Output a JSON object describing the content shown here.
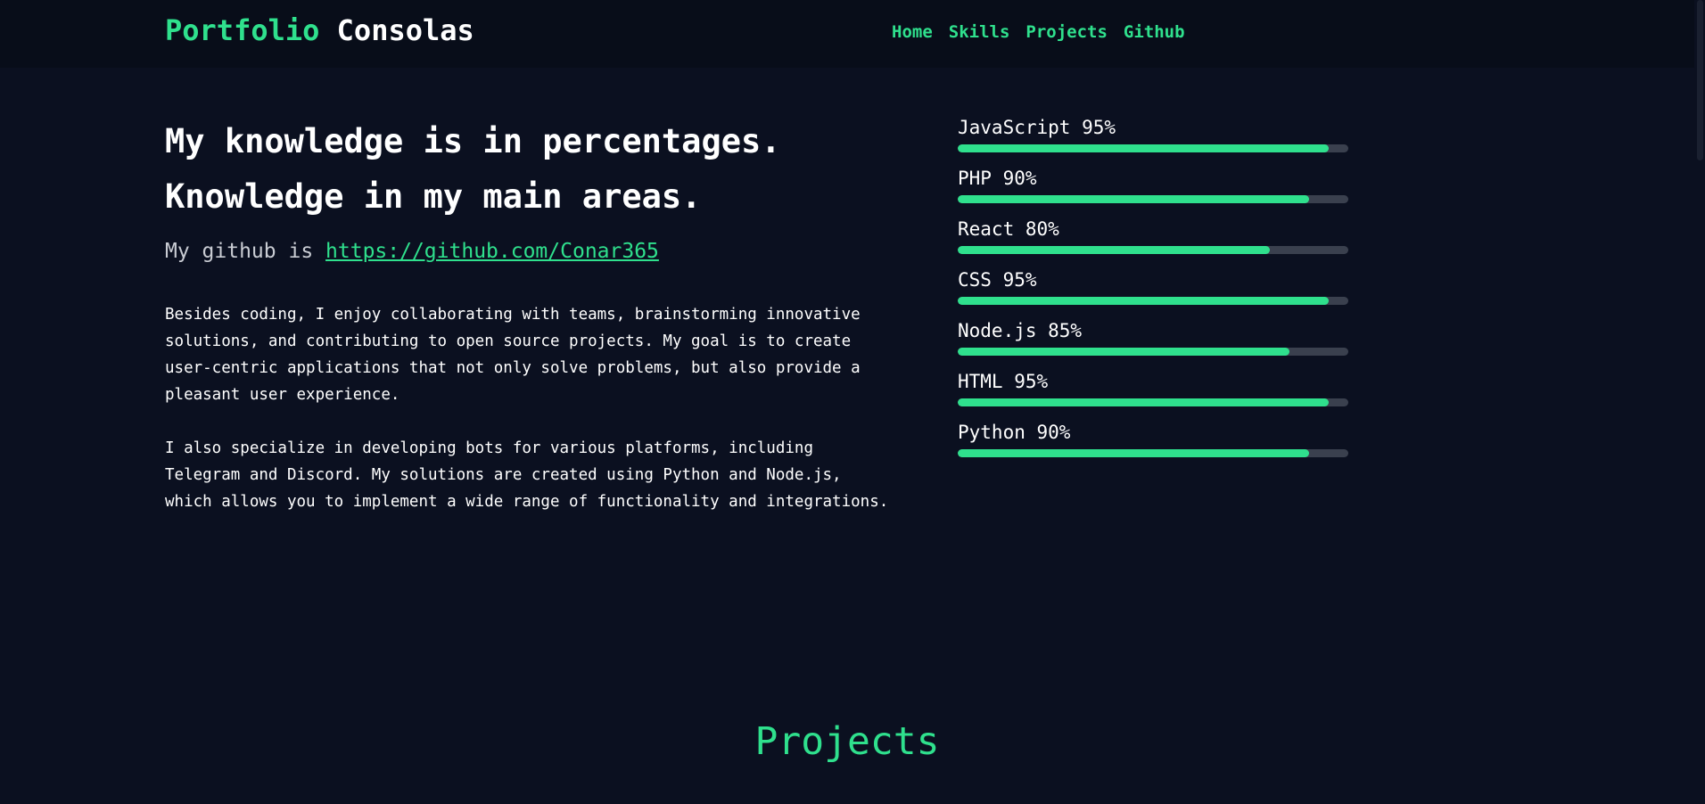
{
  "header": {
    "brand_first": "Portfolio",
    "brand_second": "Consolas",
    "nav": [
      {
        "label": "Home"
      },
      {
        "label": "Skills"
      },
      {
        "label": "Projects"
      },
      {
        "label": "Github"
      }
    ]
  },
  "about": {
    "headline_line1": "My knowledge is in percentages.",
    "headline_line2": "Knowledge in my main areas.",
    "github_prefix": "My github is",
    "github_link": "https://github.com/Conar365",
    "paragraph1": "Besides coding, I enjoy collaborating with teams, brainstorming innovative\nsolutions, and contributing to open source projects. My goal is to create\nuser-centric applications that not only solve problems, but also provide a\npleasant user experience.",
    "paragraph2": "I also specialize in developing bots for various platforms, including\nTelegram and Discord. My solutions are created using Python and Node.js,\nwhich allows you to implement a wide range of functionality and integrations."
  },
  "skills": [
    {
      "label": "JavaScript 95%",
      "percent": 95
    },
    {
      "label": "PHP 90%",
      "percent": 90
    },
    {
      "label": "React 80%",
      "percent": 80
    },
    {
      "label": "CSS 95%",
      "percent": 95
    },
    {
      "label": "Node.js 85%",
      "percent": 85
    },
    {
      "label": "HTML 95%",
      "percent": 95
    },
    {
      "label": "Python 90%",
      "percent": 90
    }
  ],
  "projects": {
    "title": "Projects"
  },
  "colors": {
    "accent": "#2fe08d",
    "background": "#0b1020",
    "header_background": "#080d19",
    "track": "#3a404e"
  }
}
